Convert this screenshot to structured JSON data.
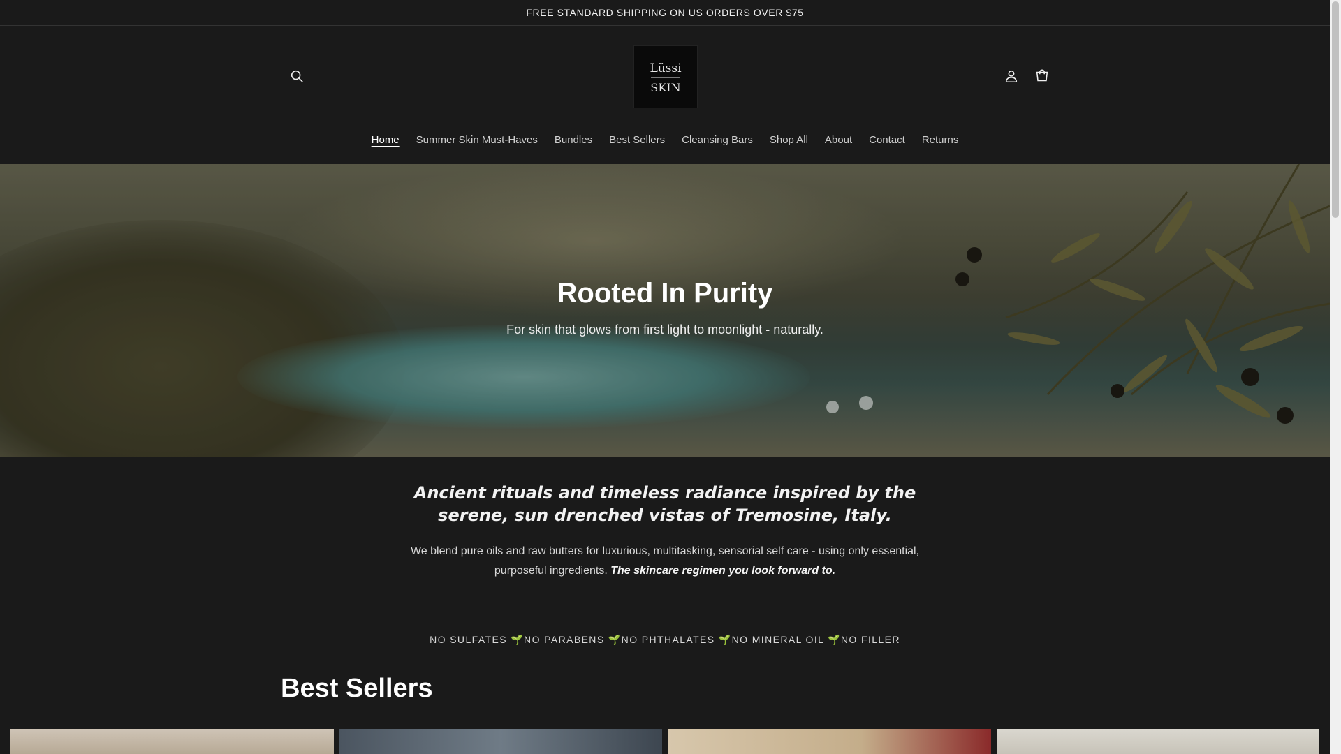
{
  "announcement": {
    "text": "FREE STANDARD SHIPPING ON US ORDERS OVER $75"
  },
  "header": {
    "logo": {
      "line1": "Lüssi",
      "line2": "SKIN"
    },
    "icons": {
      "search": "search-icon",
      "account": "account-icon",
      "cart": "cart-icon"
    }
  },
  "nav": {
    "items": [
      {
        "label": "Home",
        "active": true
      },
      {
        "label": "Summer Skin Must-Haves"
      },
      {
        "label": "Bundles"
      },
      {
        "label": "Best Sellers"
      },
      {
        "label": "Cleansing Bars"
      },
      {
        "label": "Shop All"
      },
      {
        "label": "About"
      },
      {
        "label": "Contact"
      },
      {
        "label": "Returns"
      }
    ]
  },
  "hero": {
    "title": "Rooted In Purity",
    "subtitle": "For skin that glows from first light to moonlight - naturally."
  },
  "intro": {
    "heading": "Ancient rituals and timeless radiance inspired by the serene, sun drenched vistas of Tremosine, Italy.",
    "body": "We blend pure oils and raw butters for luxurious, multitasking, sensorial self care - using only essential, purposeful ingredients.",
    "body_emphasis": "The skincare regimen you look forward to."
  },
  "badges": {
    "text": "NO SULFATES 🌱NO PARABENS 🌱NO PHTHALATES 🌱NO MINERAL OIL 🌱NO FILLER"
  },
  "best_sellers": {
    "title": "Best Sellers"
  },
  "colors": {
    "background": "#1a1a1a",
    "text": "#ffffff"
  }
}
